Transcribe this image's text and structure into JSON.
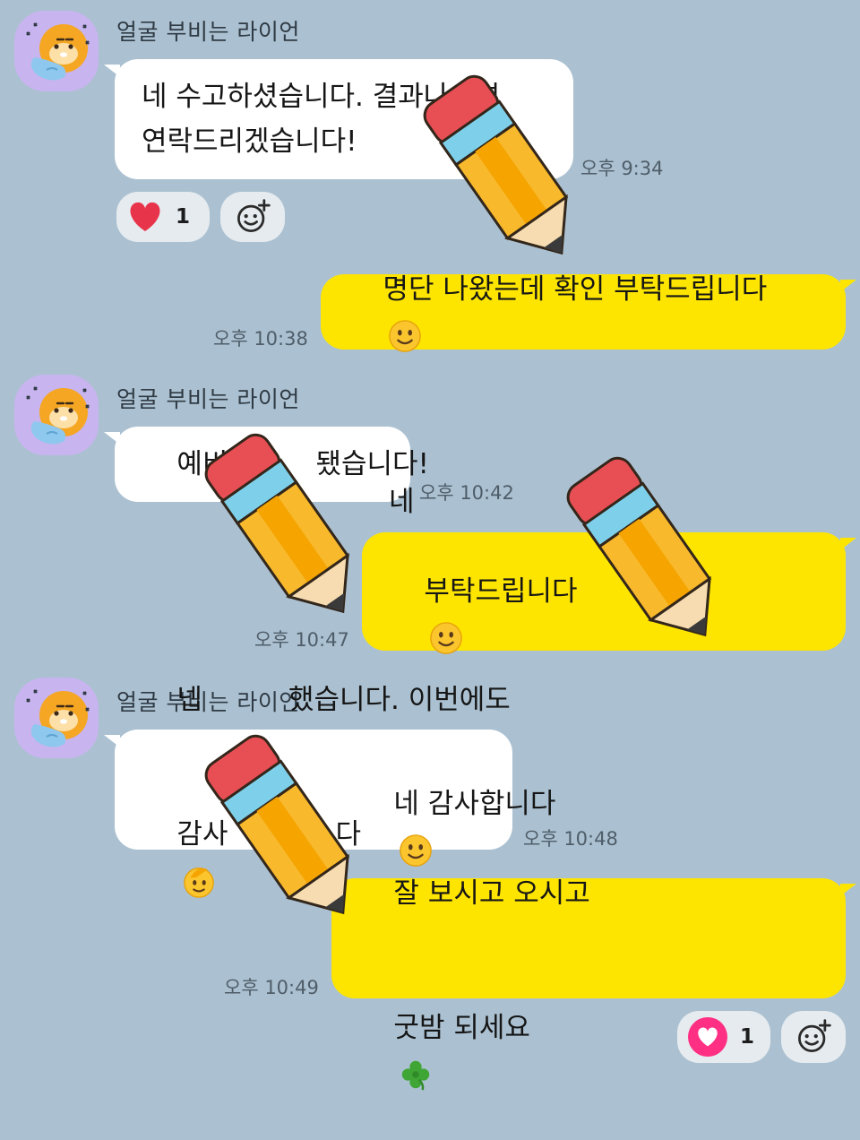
{
  "accent_colors": {
    "background": "#abc1d1",
    "incoming_bubble": "#ffffff",
    "outgoing_bubble": "#fee500",
    "reaction_heart": "#e8344a",
    "reaction_heart_badge": "#ff2f83"
  },
  "messages": [
    {
      "sender": "얼굴 부비는 라이언",
      "lines": [
        "네 수고하셨습니다. 결과나오면",
        "연락드리겠습니다!"
      ],
      "time": "오후 9:34"
    },
    {
      "lines": [
        "명단 나왔는데 확인 부탁드립니다"
      ],
      "time": "오후 10:38",
      "emoji": "slightly-smiling-face-icon"
    },
    {
      "sender": "얼굴 부비는 라이언",
      "lines": [
        "예비",
        "됐습니다!"
      ],
      "time": "오후 10:42"
    },
    {
      "lines": [
        "네",
        "부탁드립니다"
      ],
      "time": "오후 10:47",
      "emoji": "slightly-smiling-face-icon"
    },
    {
      "sender": "얼굴 부비는 라이언",
      "lines": [
        "넵",
        "했습니다. 이번에도",
        "감사",
        "다"
      ],
      "time": "오후 10:48",
      "emoji": "salute-face-icon"
    },
    {
      "lines": [
        "네 감사합니다",
        "잘 보시고 오시고",
        "굿밤 되세요"
      ],
      "time": "오후 10:49",
      "emoji": [
        "slightly-smiling-face-icon",
        "four-leaf-clover-icon"
      ]
    }
  ],
  "reactions": [
    {
      "icon": "heart-icon",
      "count": "1"
    },
    {
      "icon": "heart-icon",
      "count": "1"
    }
  ],
  "add_reaction_icon": "add-emoji-reaction-icon",
  "overlay_icon": "pencil-icon"
}
